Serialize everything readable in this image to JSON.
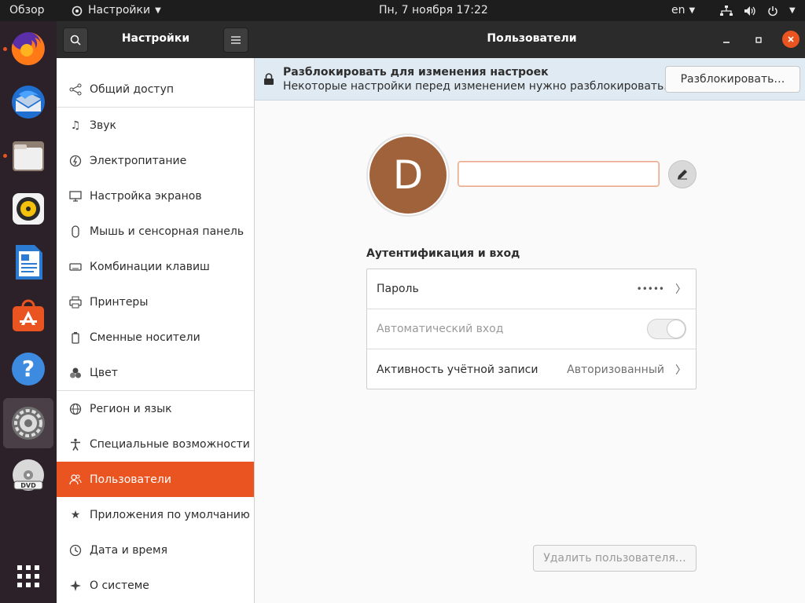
{
  "topbar": {
    "activities": "Обзор",
    "app_menu": "Настройки",
    "clock": "Пн, 7 ноября  17:22",
    "lang": "en"
  },
  "dock": {
    "items": [
      "firefox-icon",
      "thunderbird-icon",
      "files-icon",
      "rhythmbox-icon",
      "writer-icon",
      "software-icon",
      "help-icon",
      "settings-icon",
      "dvd-icon"
    ],
    "apps_grid": "show-apps-icon"
  },
  "sidebar": {
    "title": "Настройки",
    "items": [
      {
        "label": "Общий доступ",
        "icon": "share-icon"
      },
      {
        "label": "Звук",
        "icon": "music-note-icon"
      },
      {
        "label": "Электропитание",
        "icon": "power-icon"
      },
      {
        "label": "Настройка экранов",
        "icon": "display-icon"
      },
      {
        "label": "Мышь и сенсорная панель",
        "icon": "mouse-icon"
      },
      {
        "label": "Комбинации клавиш",
        "icon": "keyboard-icon"
      },
      {
        "label": "Принтеры",
        "icon": "printer-icon"
      },
      {
        "label": "Сменные носители",
        "icon": "removable-media-icon"
      },
      {
        "label": "Цвет",
        "icon": "color-icon"
      },
      {
        "label": "Регион и язык",
        "icon": "globe-icon"
      },
      {
        "label": "Специальные возможности",
        "icon": "accessibility-icon"
      },
      {
        "label": "Пользователи",
        "icon": "users-icon"
      },
      {
        "label": "Приложения по умолчанию",
        "icon": "star-icon"
      },
      {
        "label": "Дата и время",
        "icon": "clock-icon"
      },
      {
        "label": "О системе",
        "icon": "sparkle-icon"
      }
    ],
    "selected_index": 11
  },
  "header": {
    "title": "Пользователи"
  },
  "infobar": {
    "title": "Разблокировать для изменения настроек",
    "subtitle": "Некоторые настройки перед изменением нужно разблокировать.",
    "button": "Разблокировать…"
  },
  "user": {
    "avatar_letter": "D",
    "avatar_color": "#a0623a",
    "name_value": ""
  },
  "auth": {
    "section_title": "Аутентификация и вход",
    "password_label": "Пароль",
    "password_value": "•••••",
    "autologin_label": "Автоматический вход",
    "autologin_on": false,
    "activity_label": "Активность учётной записи",
    "activity_value": "Авторизованный"
  },
  "remove_button": "Удалить пользователя…",
  "colors": {
    "accent": "#e95420",
    "dock": "#2c2029"
  }
}
